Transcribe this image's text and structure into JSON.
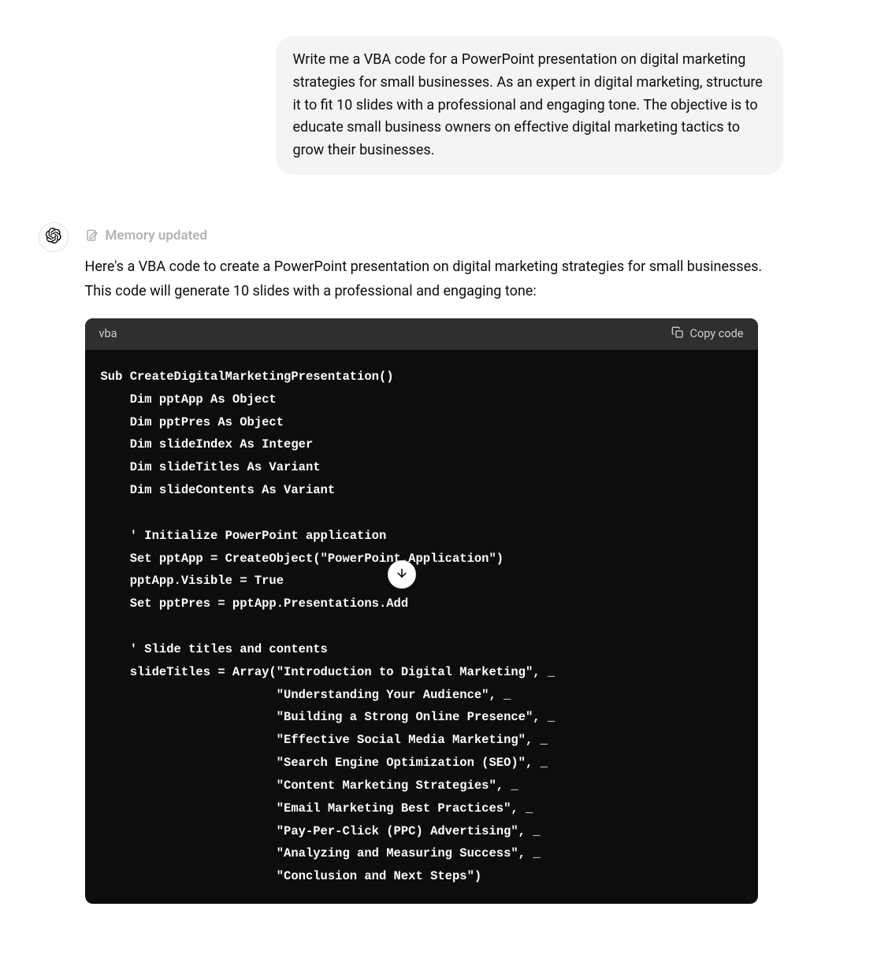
{
  "user_message": "Write me a VBA code for a PowerPoint presentation on digital marketing strategies for small businesses. As an expert in digital marketing, structure it to fit 10 slides with a professional and engaging tone. The objective is to educate small business owners on effective digital marketing tactics to grow their businesses.",
  "memory_status": "Memory updated",
  "assistant_intro": "Here's a VBA code to create a PowerPoint presentation on digital marketing strategies for small businesses. This code will generate 10 slides with a professional and engaging tone:",
  "code": {
    "language": "vba",
    "copy_label": "Copy code",
    "content": "Sub CreateDigitalMarketingPresentation()\n    Dim pptApp As Object\n    Dim pptPres As Object\n    Dim slideIndex As Integer\n    Dim slideTitles As Variant\n    Dim slideContents As Variant\n\n    ' Initialize PowerPoint application\n    Set pptApp = CreateObject(\"PowerPoint.Application\")\n    pptApp.Visible = True\n    Set pptPres = pptApp.Presentations.Add\n\n    ' Slide titles and contents\n    slideTitles = Array(\"Introduction to Digital Marketing\", _\n                        \"Understanding Your Audience\", _\n                        \"Building a Strong Online Presence\", _\n                        \"Effective Social Media Marketing\", _\n                        \"Search Engine Optimization (SEO)\", _\n                        \"Content Marketing Strategies\", _\n                        \"Email Marketing Best Practices\", _\n                        \"Pay-Per-Click (PPC) Advertising\", _\n                        \"Analyzing and Measuring Success\", _\n                        \"Conclusion and Next Steps\")"
  }
}
